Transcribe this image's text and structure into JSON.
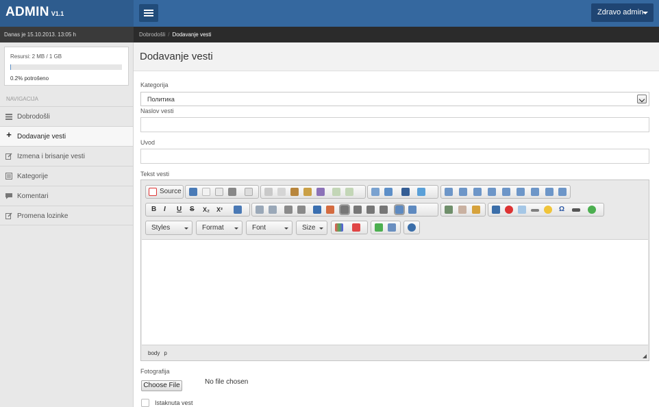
{
  "header": {
    "brand": "ADMIN",
    "version": "V1.1",
    "user_menu": "Zdravo admin"
  },
  "datebar": {
    "text": "Danas je 15.10.2013. 13:05 h"
  },
  "breadcrumb": {
    "home": "Dobrodošli",
    "current": "Dodavanje vesti"
  },
  "resources": {
    "label": "Resursi: 2 MB / 1 GB",
    "used_text": "0.2% potrošeno",
    "used_fraction": 0.002
  },
  "sidebar": {
    "header": "NAVIGACIJA",
    "items": [
      {
        "label": "Dobrodošli",
        "icon": "dashboard-icon",
        "active": false
      },
      {
        "label": "Dodavanje vesti",
        "icon": "plus-icon",
        "active": true
      },
      {
        "label": "Izmena i brisanje vesti",
        "icon": "edit-icon",
        "active": false
      },
      {
        "label": "Kategorije",
        "icon": "list-icon",
        "active": false
      },
      {
        "label": "Komentari",
        "icon": "comment-icon",
        "active": false
      },
      {
        "label": "Promena lozinke",
        "icon": "edit-icon",
        "active": false
      }
    ]
  },
  "page": {
    "title": "Dodavanje vesti",
    "category_label": "Kategorija",
    "category_value": "Политика",
    "headline_label": "Naslov vesti",
    "headline_value": "",
    "intro_label": "Uvod",
    "intro_value": "",
    "text_label": "Tekst vesti",
    "photo_label": "Fotografija",
    "choose_file": "Choose File",
    "no_file": "No file chosen",
    "featured_label": "Istaknuta vest"
  },
  "editor": {
    "source_label": "Source",
    "bold": "B",
    "italic": "I",
    "underline": "U",
    "strike": "S",
    "subscript": "X₂",
    "superscript": "X²",
    "combos": [
      "Styles",
      "Format",
      "Font",
      "Size"
    ],
    "path": [
      "body",
      "p"
    ]
  }
}
